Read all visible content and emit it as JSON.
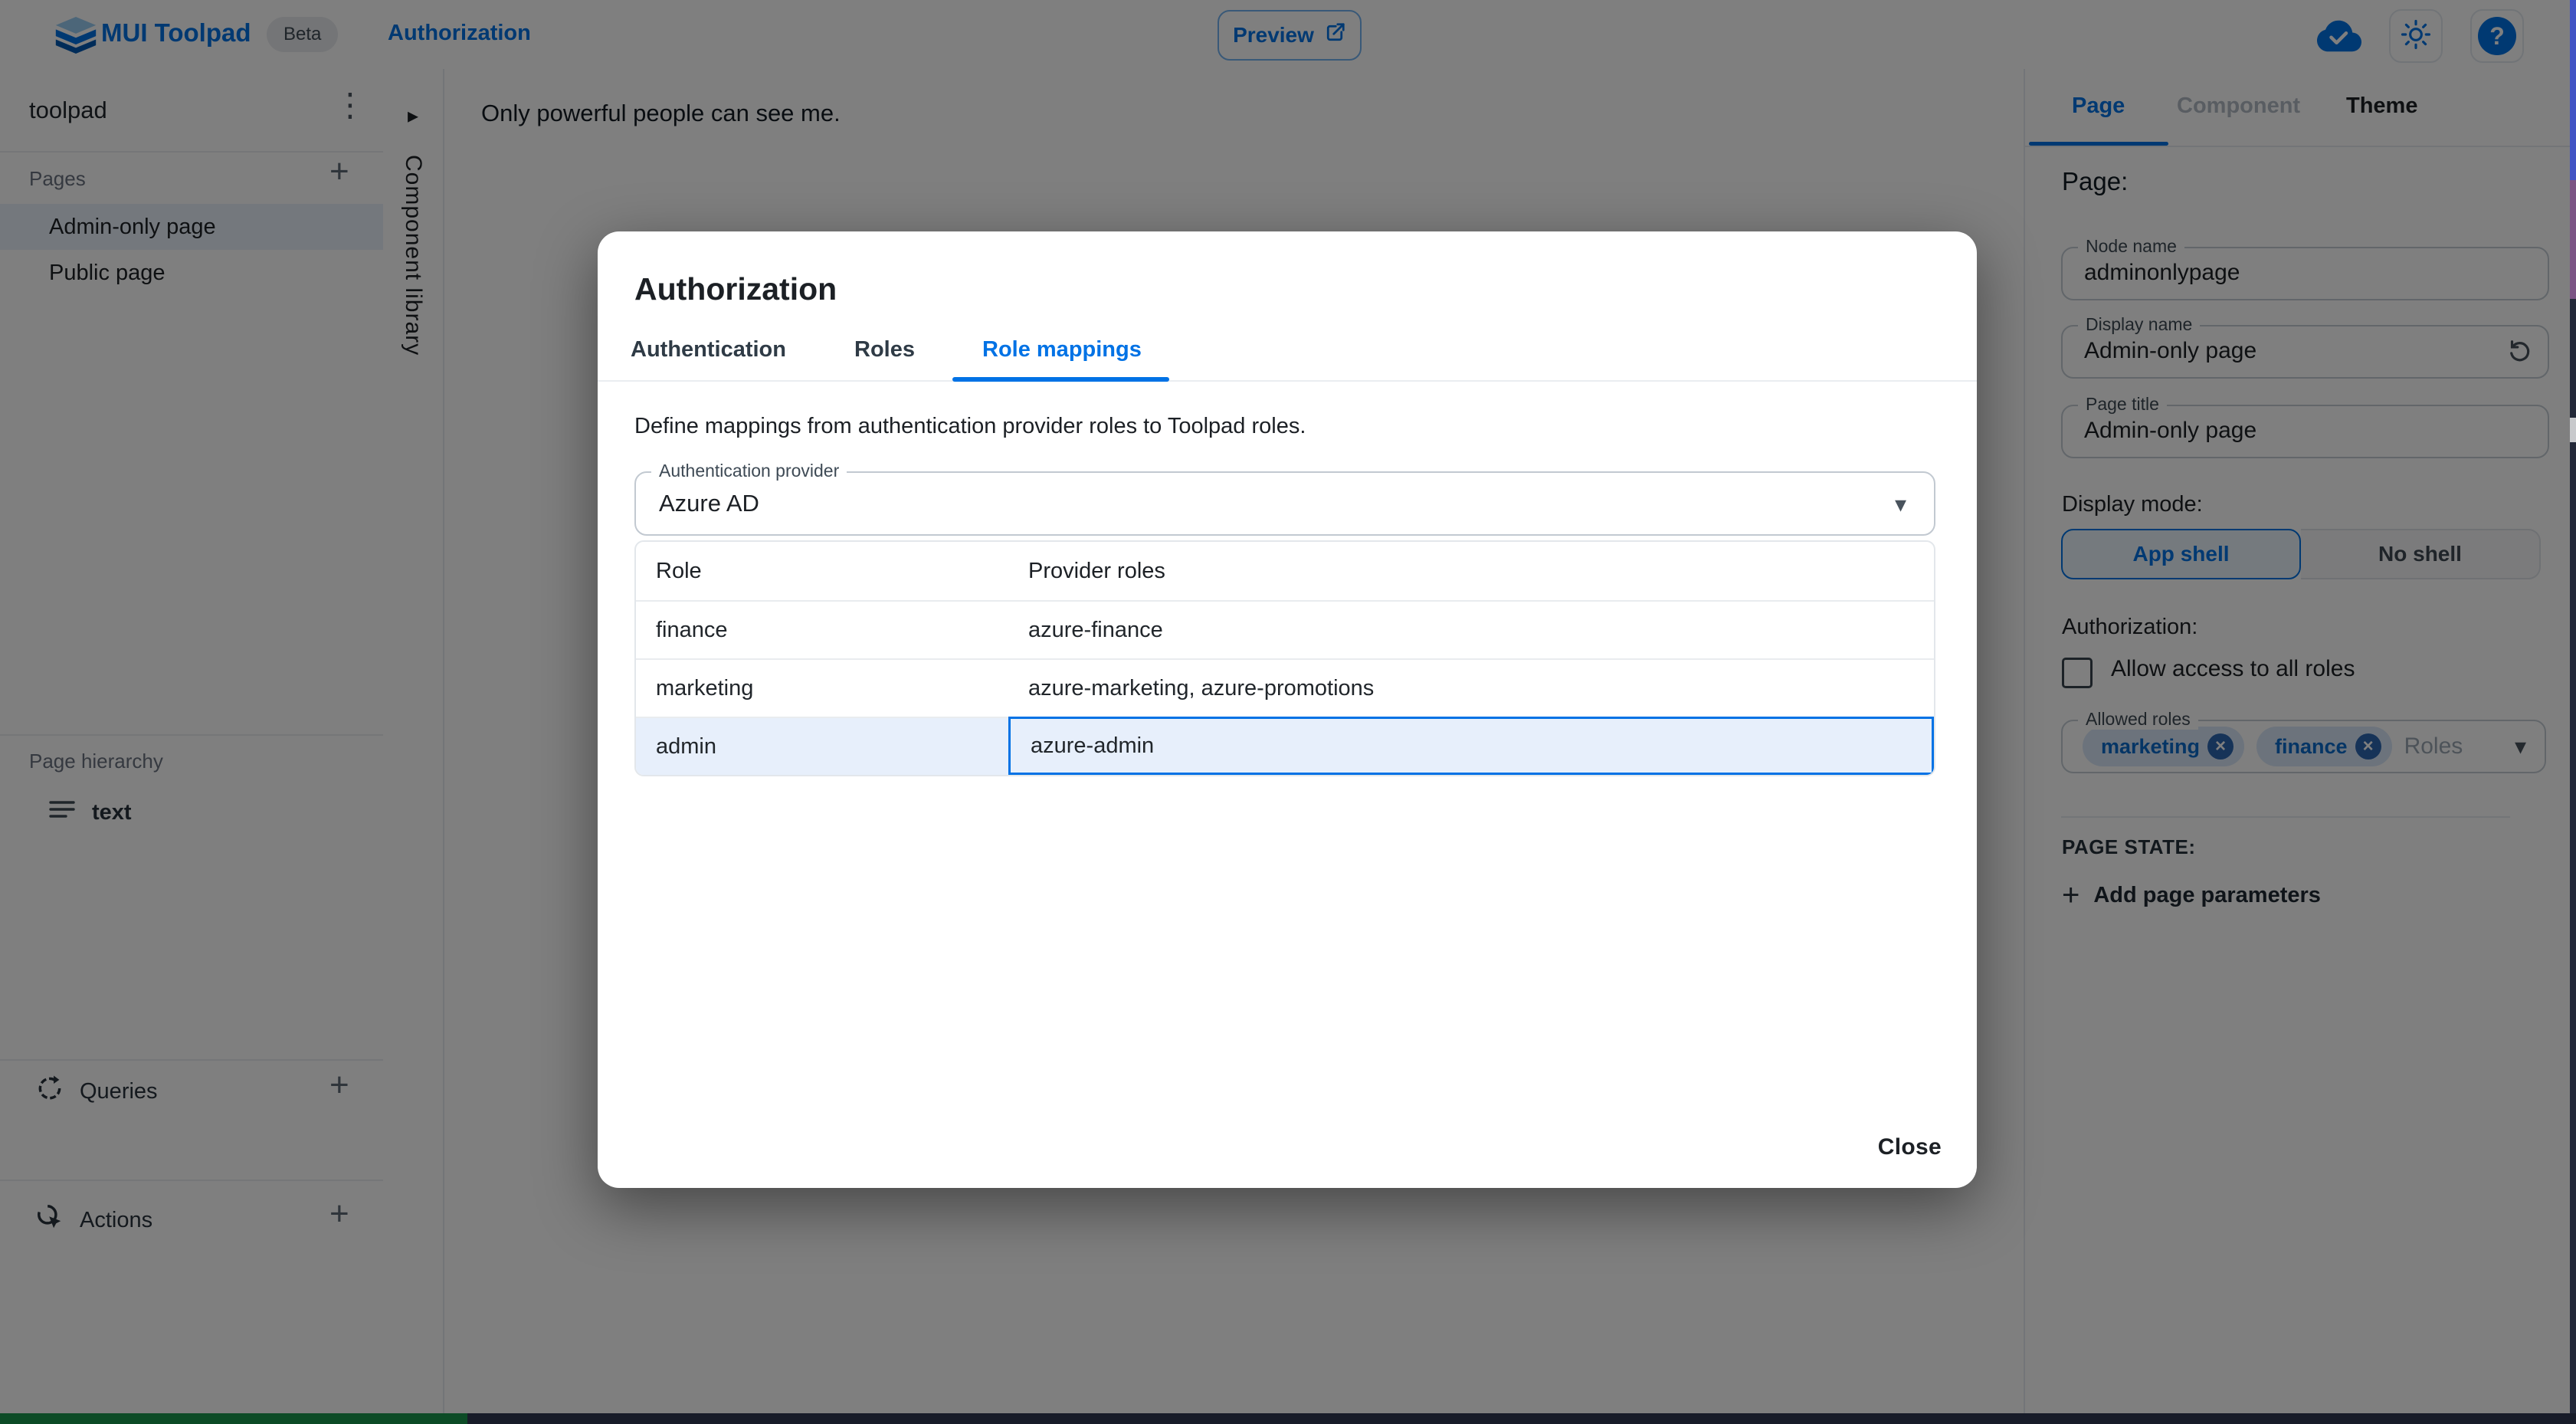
{
  "header": {
    "app_title": "MUI Toolpad",
    "beta_label": "Beta",
    "page_title": "Authorization",
    "preview_label": "Preview"
  },
  "sidebar": {
    "project_name": "toolpad",
    "pages_section": "Pages",
    "pages": [
      {
        "label": "Admin-only page",
        "selected": true
      },
      {
        "label": "Public page",
        "selected": false
      }
    ],
    "hierarchy_section": "Page hierarchy",
    "hierarchy": [
      {
        "label": "text"
      }
    ],
    "queries_section": "Queries",
    "actions_section": "Actions"
  },
  "component_library": {
    "label": "Component library"
  },
  "canvas": {
    "text": "Only powerful people can see me."
  },
  "dialog": {
    "title": "Authorization",
    "tabs": [
      "Authentication",
      "Roles",
      "Role mappings"
    ],
    "active_tab": "Role mappings",
    "description": "Define mappings from authentication provider roles to Toolpad roles.",
    "provider_field": {
      "label": "Authentication provider",
      "value": "Azure AD"
    },
    "grid": {
      "columns": [
        "Role",
        "Provider roles"
      ],
      "rows": [
        {
          "role": "finance",
          "provider_roles": "azure-finance",
          "selected": false
        },
        {
          "role": "marketing",
          "provider_roles": "azure-marketing, azure-promotions",
          "selected": false
        },
        {
          "role": "admin",
          "provider_roles": "azure-admin",
          "selected": true
        }
      ]
    },
    "close_label": "Close"
  },
  "panel": {
    "tabs": [
      "Page",
      "Component",
      "Theme"
    ],
    "active_tab": "Page",
    "heading": "Page:",
    "node_name": {
      "label": "Node name",
      "value": "adminonlypage"
    },
    "display_name": {
      "label": "Display name",
      "value": "Admin-only page"
    },
    "page_title_field": {
      "label": "Page title",
      "value": "Admin-only page"
    },
    "display_mode_label": "Display mode:",
    "display_mode_options": [
      "App shell",
      "No shell"
    ],
    "display_mode_selected": "App shell",
    "authorization_label": "Authorization:",
    "allow_all_label": "Allow access to all roles",
    "allow_all_checked": false,
    "allowed_roles": {
      "label": "Allowed roles",
      "chips": [
        "marketing",
        "finance"
      ],
      "placeholder": "Roles"
    },
    "page_state_label": "PAGE STATE:",
    "add_page_parameters_label": "Add page parameters"
  },
  "icons": {
    "kebab": "⋮",
    "plus": "+",
    "caret_down": "▾",
    "chevron_right": "▸",
    "help": "?",
    "chip_remove": "×"
  },
  "colors": {
    "primary": "#0072E5",
    "selected_row_bg": "#E7EFFB",
    "sidebar_selected_bg": "#E9F1FB",
    "border": "#E7EBF0",
    "text_primary": "#1C2025",
    "text_secondary": "#6B7280"
  }
}
